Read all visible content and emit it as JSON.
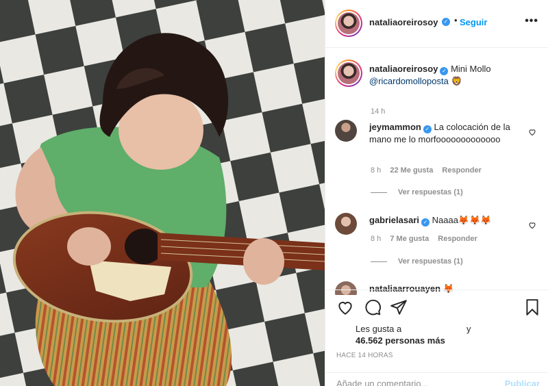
{
  "post": {
    "username": "nataliaoreirosoy",
    "follow_label": "Seguir",
    "more_label": "•••",
    "caption": {
      "username": "nataliaoreirosoy",
      "text": "Mini Mollo",
      "mention": "@ricardomolloposta",
      "emoji": "🦁",
      "time": "14 h"
    }
  },
  "comments": [
    {
      "username": "jeymammon",
      "text": "La colocación de la mano me lo morfooooooooooooo",
      "time": "8 h",
      "likes": "22 Me gusta",
      "reply": "Responder",
      "replies": "Ver respuestas (1)"
    },
    {
      "username": "gabrielasari",
      "text": "Naaaa🦊🦊🦊",
      "time": "8 h",
      "likes": "7 Me gusta",
      "reply": "Responder",
      "replies": "Ver respuestas (1)"
    },
    {
      "username": "nataliaarrouayen",
      "text": "🦊"
    }
  ],
  "likes": {
    "prefix": "Les gusta a",
    "and": "y",
    "count": "46.562 personas más"
  },
  "timestamp": "HACE 14 HORAS",
  "add_comment": {
    "placeholder": "Añade un comentario...",
    "publish": "Publicar"
  },
  "icons": {
    "like": "heart-icon",
    "comment": "comment-icon",
    "share": "share-icon",
    "save": "bookmark-icon",
    "more": "more-icon",
    "verified": "verified-badge-icon"
  },
  "colors": {
    "link_blue": "#0095f6",
    "verified_blue": "#3897f0",
    "meta_gray": "#8e8e8e",
    "publish_disabled": "#b2dffc"
  }
}
